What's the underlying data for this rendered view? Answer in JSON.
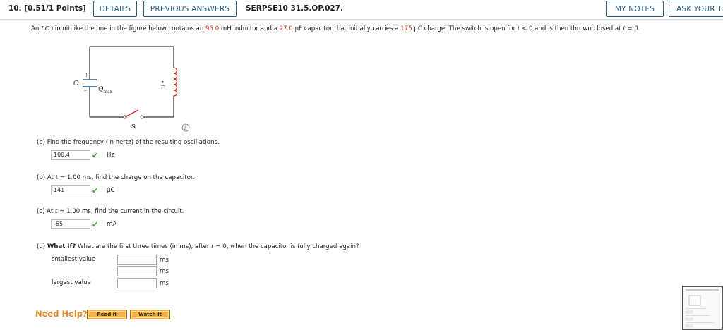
{
  "header": {
    "question_number": "10.  [0.51/1 Points]",
    "details_label": "DETAILS",
    "previous_answers_label": "PREVIOUS ANSWERS",
    "problem_code": "SERPSE10 31.5.OP.027.",
    "my_notes_label": "MY NOTES",
    "ask_teacher_label": "ASK YOUR TE"
  },
  "problem": {
    "text_1": "An ",
    "lc": "LC",
    "text_2": " circuit like the one in the figure below contains an ",
    "inductance": "95.0",
    "text_3": " mH inductor and a ",
    "capacitance": "27.0",
    "text_4": " µF capacitor that initially carries a ",
    "charge": "175",
    "text_5": " µC charge. The switch is open for ",
    "t1": "t",
    "text_6": " < 0 and is then thrown closed at ",
    "t2": "t",
    "text_7": " = 0."
  },
  "figure": {
    "cap_label": "C",
    "plus": "+",
    "minus": "–",
    "qmax_q": "Q",
    "qmax_sub": "max",
    "ind_label": "L",
    "switch_label": "S",
    "info": "i"
  },
  "parts": {
    "a": {
      "prompt": "(a)   Find the frequency (in hertz) of the resulting oscillations.",
      "answer": "100.4",
      "unit": "Hz"
    },
    "b": {
      "prompt_pre": "(b)   At ",
      "t": "t",
      "prompt_post": " = 1.00 ms, find the charge on the capacitor.",
      "answer": "141",
      "unit": "µC"
    },
    "c": {
      "prompt_pre": "(c)   At ",
      "t": "t",
      "prompt_post": " = 1.00 ms, find the current in the circuit.",
      "answer": "-65",
      "unit": "mA"
    },
    "d": {
      "label": "(d)   ",
      "whatif": "What If?",
      "prompt_pre": " What are the first three times (in ms), after ",
      "t": "t",
      "prompt_post": " = 0, when the capacitor is fully charged again?",
      "smallest_label": "smallest value",
      "largest_label": "largest value",
      "unit1": "ms",
      "unit2": "ms",
      "unit3": "ms"
    }
  },
  "help": {
    "need_help": "Need Help?",
    "read_it": "Read It",
    "watch_it": "Watch It"
  },
  "colors": {
    "accent": "#2a5d8a",
    "value_red": "#c8331f",
    "check_green": "#3a9a2a",
    "help_orange": "#e08a2a"
  }
}
